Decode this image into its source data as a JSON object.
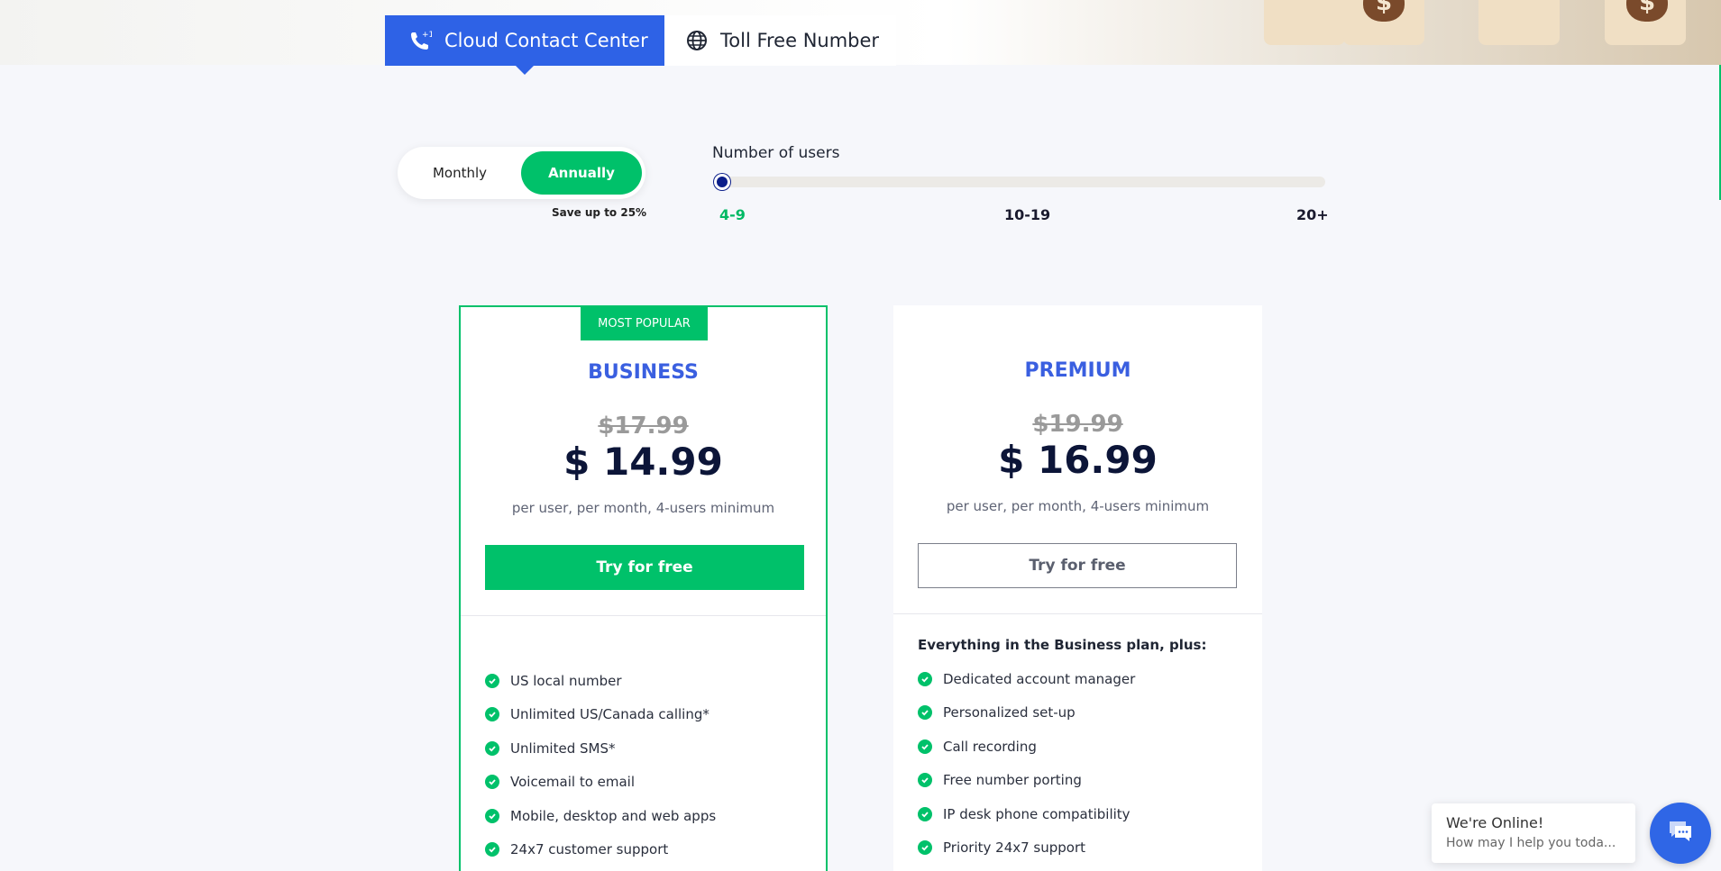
{
  "tabs": [
    {
      "label": "Cloud Contact Center",
      "icon": "phone-plus-icon",
      "active": true
    },
    {
      "label": "Toll Free Number",
      "icon": "globe-icon",
      "active": false
    }
  ],
  "billing": {
    "monthly_label": "Monthly",
    "annually_label": "Annually",
    "selected": "Annually",
    "save_note": "Save up to 25%"
  },
  "users": {
    "label": "Number of users",
    "ticks": [
      "4-9",
      "10-19",
      "20+"
    ],
    "selected": "4-9"
  },
  "plans": [
    {
      "badge": "MOST POPULAR",
      "name": "BUSINESS",
      "old_price": "$17.99",
      "price": "$ 14.99",
      "price_note": "per user, per month, 4-users minimum",
      "cta": "Try for free",
      "features": [
        "US local number",
        "Unlimited US/Canada calling*",
        "Unlimited SMS*",
        "Voicemail to email",
        "Mobile, desktop and web apps",
        "24x7 customer support"
      ]
    },
    {
      "name": "PREMIUM",
      "old_price": "$19.99",
      "price": "$ 16.99",
      "price_note": "per user, per month, 4-users minimum",
      "cta": "Try for free",
      "plus_heading": "Everything in the Business plan, plus:",
      "features": [
        "Dedicated account manager",
        "Personalized set-up",
        "Call recording",
        "Free number porting",
        "IP desk phone compatibility",
        "Priority 24x7 support"
      ]
    }
  ],
  "chat": {
    "title": "We're Online!",
    "subtitle": "How may I help you toda..."
  },
  "colors": {
    "accent_blue": "#2e62e6",
    "accent_green": "#00c16a",
    "price_dark": "#0c1538"
  }
}
